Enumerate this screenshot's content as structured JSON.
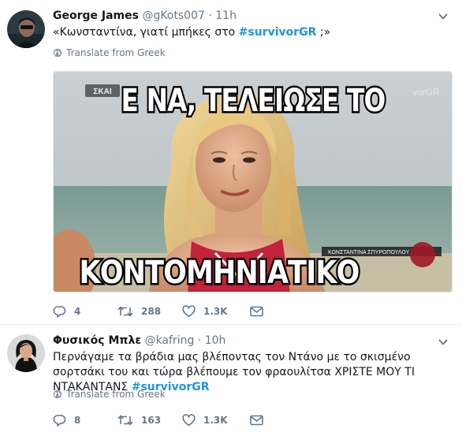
{
  "tweets": [
    {
      "name": "George James",
      "handle": "@gKots007",
      "time": "11h",
      "text_before": "«Κωνσταντίνα, γιατί μπήκες στο ",
      "hashtag": "#survivorGR",
      "text_after": " ;»",
      "translate": "Translate from Greek",
      "media": {
        "top_caption": "Ε ΝΑ, ΤΕΛΕΙΩΣΕ ΤΟ",
        "bottom_caption": "ΚΟΝΤΟΜΗΝΙΑΤΙΚΟ",
        "channel_logo": "ΣΚΑΙ",
        "watermark": "vorGR",
        "lower_third": "ΚΩΝΣΤΑΝΤΙΝΑ ΣΠΥΡΟΠΟΥΛΟΥ"
      },
      "stats": {
        "replies": "4",
        "retweets": "288",
        "likes": "1.3K"
      }
    },
    {
      "name": "Φυσικός Μπλε",
      "handle": "@kafring",
      "time": "10h",
      "text_before": "Περνάγαμε τα βράδια μας βλέποντας τον Ντάνο με το σκισμένο σορτσάκι του και τώρα βλέπουμε τον φραουλίτσα ΧΡΙΣΤΕ ΜΟΥ ΤΙ ΝΤΑΚΑΝΤΑΝΣ ",
      "hashtag": "#survivorGR",
      "text_after": "",
      "translate": "Translate from Greek",
      "stats": {
        "replies": "8",
        "retweets": "163",
        "likes": "1.3K"
      }
    }
  ],
  "colors": {
    "hashtag": "#1b95e0",
    "muted": "#657786",
    "text": "#14171a"
  },
  "icons": [
    "avatar",
    "caret-down-icon",
    "globe-icon",
    "reply-icon",
    "retweet-icon",
    "like-icon",
    "dm-icon"
  ]
}
